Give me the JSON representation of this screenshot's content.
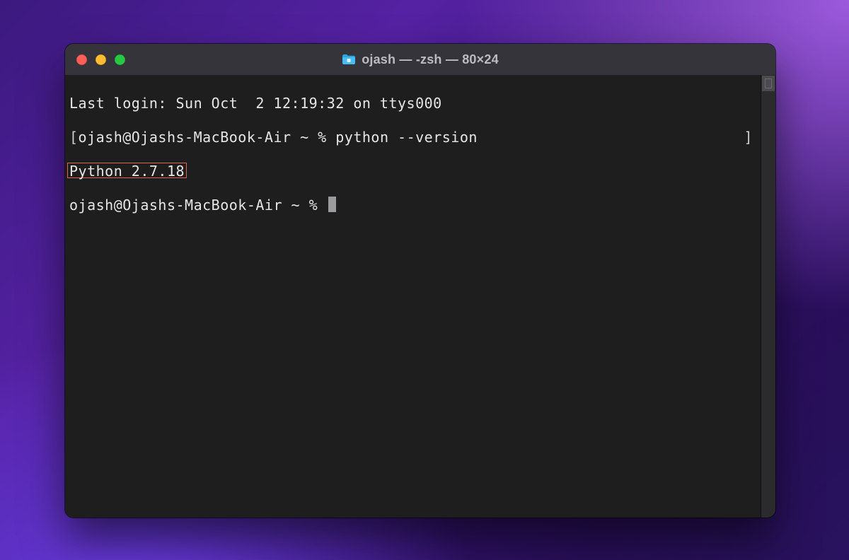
{
  "window": {
    "title": "ojash — -zsh — 80×24",
    "traffic": {
      "close": "#ff5f57",
      "minimize": "#febc2e",
      "zoom": "#28c840"
    }
  },
  "terminal": {
    "last_login": "Last login: Sun Oct  2 12:19:32 on ttys000",
    "prompt1_open": "[",
    "prompt1_text": "ojash@Ojashs-MacBook-Air ~ % ",
    "command1": "python --version",
    "prompt1_close": "]",
    "output_highlighted": "Python 2.7.18",
    "prompt2_text": "ojash@Ojashs-MacBook-Air ~ % "
  }
}
